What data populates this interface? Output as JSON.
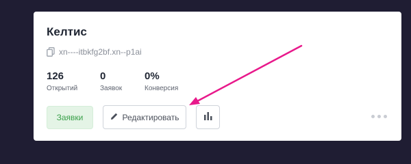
{
  "card": {
    "title": "Келтис",
    "domain": "xn----itbkfg2bf.xn--p1ai"
  },
  "stats": [
    {
      "value": "126",
      "label": "Открытий"
    },
    {
      "value": "0",
      "label": "Заявок"
    },
    {
      "value": "0%",
      "label": "Конверсия"
    }
  ],
  "actions": {
    "requests_label": "Заявки",
    "edit_label": "Редактировать"
  },
  "colors": {
    "background": "#1f1d33",
    "card": "#ffffff",
    "requests_bg": "#e4f4e6",
    "requests_text": "#3aa04a",
    "arrow": "#e8198b"
  },
  "icons": {
    "copy": "copy-icon",
    "edit": "pencil-icon",
    "stats": "bar-chart-icon",
    "more": "more-dots-icon"
  }
}
